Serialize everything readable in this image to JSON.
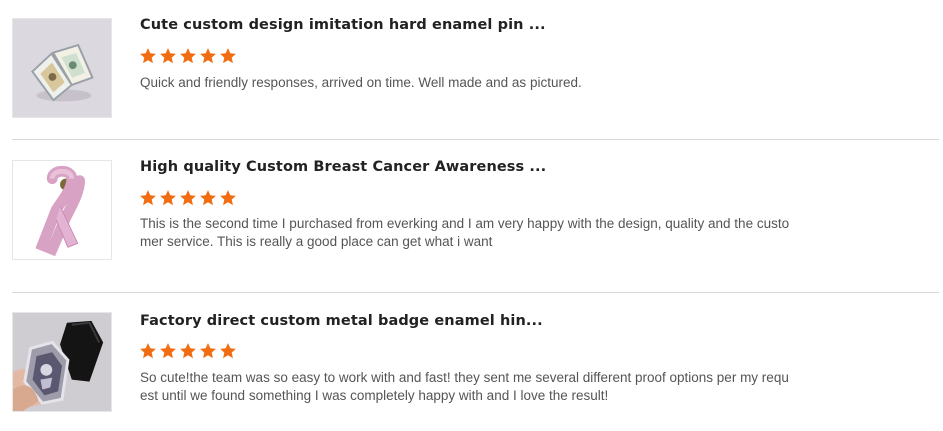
{
  "reviews": [
    {
      "title": "Cute custom design imitation hard enamel pin ...",
      "rating": 5,
      "comment": "Quick and friendly responses, arrived on time. Well made and as pictured.",
      "image_icon": "enamel-pin-book-image"
    },
    {
      "title": "High quality Custom Breast Cancer Awareness ...",
      "rating": 5,
      "comment": "This is the second time I purchased from everking and I am very happy with the design, quality and the customer service. This is really a good place can get what i want",
      "image_icon": "pink-ribbon-pin-image"
    },
    {
      "title": "Factory direct custom metal badge enamel hin...",
      "rating": 5,
      "comment": "So cute!the team was so easy to work with and fast! they sent me several different proof options per my request until we found something I was completely happy with and I love the result!",
      "image_icon": "coffin-hinged-pin-image"
    }
  ],
  "colors": {
    "star": "#f26c12",
    "divider": "#d9d9d9",
    "title": "#222222",
    "comment": "#555555"
  }
}
